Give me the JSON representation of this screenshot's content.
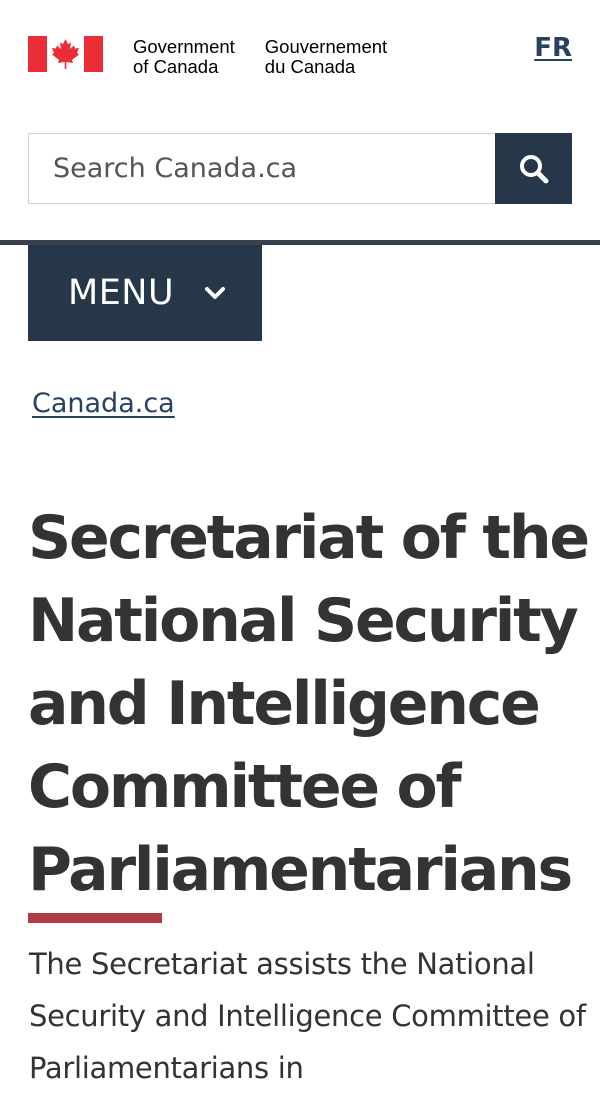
{
  "header": {
    "signature": {
      "en_line1": "Government",
      "en_line2": "of Canada",
      "fr_line1": "Gouvernement",
      "fr_line2": "du Canada",
      "flag_icon": "canada-flag-icon"
    },
    "language_toggle": "FR"
  },
  "search": {
    "placeholder": "Search Canada.ca",
    "button_icon": "search-icon"
  },
  "menu": {
    "label": "MENU",
    "icon": "chevron-down-icon"
  },
  "breadcrumb": {
    "items": [
      {
        "label": "Canada.ca"
      }
    ]
  },
  "main": {
    "title": "Secretariat of the National Security and Intelligence Committee of Parliamentarians",
    "intro": "The Secretariat assists the National Security and Intelligence Committee of Parliamentarians in"
  },
  "colors": {
    "flag_red": "#eb2d37",
    "navy": "#26374a",
    "link": "#284162",
    "title_rule": "#af3c43",
    "text": "#333333"
  }
}
